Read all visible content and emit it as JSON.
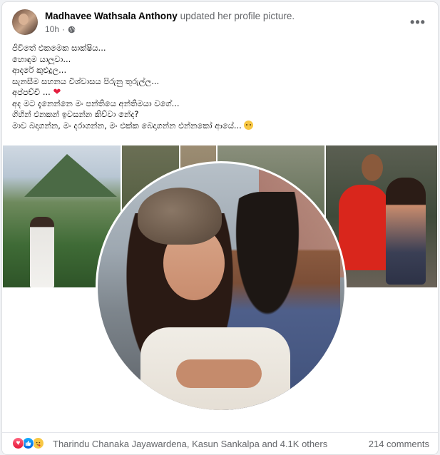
{
  "post": {
    "author": "Madhavee Wathsala Anthony",
    "action": "updated her profile picture.",
    "timestamp": "10h",
    "separator": "·",
    "audience_icon": "globe-icon",
    "more_icon": "more-options-icon",
    "more_label": "•••",
    "lines": [
      "ජීවිතේ එකමෙක සාක්ෂිය...",
      "හොඳම යාලුවා...",
      "ආදරේ කුළුදුල...",
      "සැනසීම සහනය විශ්වාසය පිරුනු තුරුල්ල...",
      "අප්පච්චි ...",
      "අද මට දැනෙන්නෙ මං පන්තියෙ අන්තිමයා වගේ...",
      "ගිහින් එනකන් ඉවසන්න කිව්වා නේද?",
      "මාව බදාගන්න, මං දරාගන්න, මං එක්ක බෙදාගන්න එන්නකෝ ආයේ..."
    ],
    "heart_emoji": "❤",
    "images": {
      "profile_picture": "profile-photo-couple",
      "background_photos": [
        "mountain-photo",
        "hiking-photo-1",
        "hiking-photo-2",
        "hiking-photo-3",
        "hug-photo"
      ]
    }
  },
  "footer": {
    "reaction_icons": [
      "love-reaction-icon",
      "like-reaction-icon",
      "care-reaction-icon"
    ],
    "reaction_names": "Tharindu Chanaka Jayawardena, Kasun Sankalpa and 4.1K others",
    "comments": "214 comments"
  },
  "colors": {
    "background": "#f0f2f5",
    "card": "#ffffff",
    "secondary_text": "#65676b",
    "love": "#e41e3f",
    "like": "#0866ff"
  }
}
